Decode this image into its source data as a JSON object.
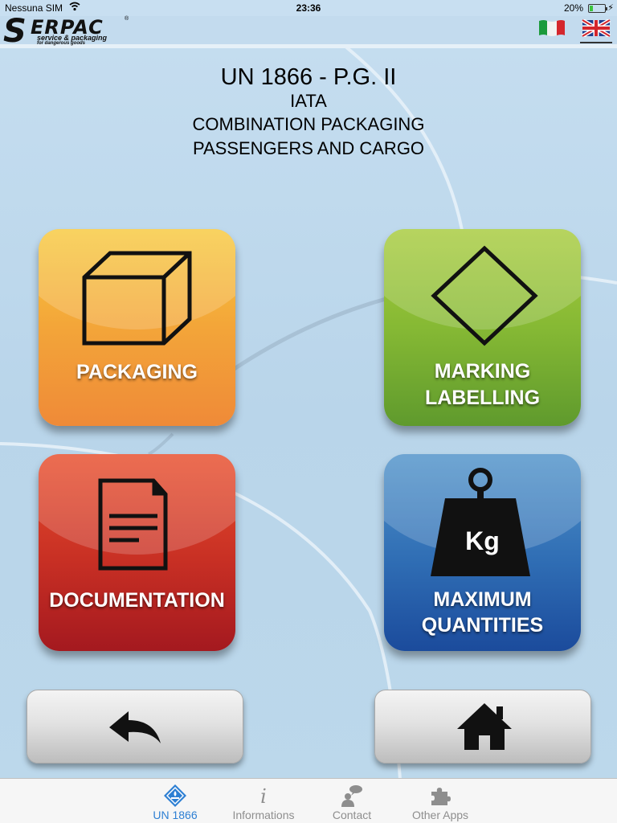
{
  "status_bar": {
    "carrier": "Nessuna SIM",
    "time": "23:36",
    "battery": "20%",
    "battery_level": 0.2
  },
  "header": {
    "logo_letter": "S",
    "logo_text": "ERPAC",
    "logo_registered": "®",
    "logo_tagline": "service & packaging",
    "logo_subtagline": "for dangerous goods",
    "languages": [
      "italian-flag",
      "uk-flag"
    ],
    "selected_language": "uk-flag"
  },
  "titles": {
    "line1": "UN 1866 - P.G. II",
    "line2": "IATA",
    "line3": "COMBINATION PACKAGING",
    "line4": "PASSENGERS AND CARGO"
  },
  "tiles": {
    "packaging": {
      "label": "PACKAGING",
      "icon": "box-icon"
    },
    "marking": {
      "label_line1": "MARKING",
      "label_line2": "LABELLING",
      "icon": "diamond-icon"
    },
    "documentation": {
      "label": "DOCUMENTATION",
      "icon": "document-icon"
    },
    "quantities": {
      "label_line1": "MAXIMUM",
      "label_line2": "QUANTITIES",
      "icon": "weight-icon",
      "weight_text": "Kg"
    }
  },
  "nav": {
    "back_icon": "back-arrow-icon",
    "home_icon": "home-icon"
  },
  "tab_bar": {
    "tabs": [
      {
        "label": "UN 1866",
        "icon": "hazard-diamond-icon",
        "active": true
      },
      {
        "label": "Informations",
        "icon": "info-icon",
        "active": false
      },
      {
        "label": "Contact",
        "icon": "contact-icon",
        "active": false
      },
      {
        "label": "Other Apps",
        "icon": "puzzle-icon",
        "active": false
      }
    ]
  },
  "colors": {
    "background": "#bcd8eb",
    "packaging": "#f3a539",
    "marking": "#86b934",
    "documentation": "#c72f24",
    "quantities": "#2f6db4",
    "tab_active": "#2d7fd3",
    "tab_inactive": "#8e8e8e"
  }
}
